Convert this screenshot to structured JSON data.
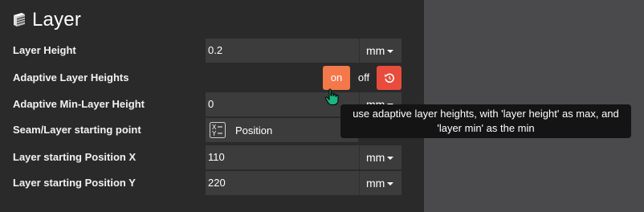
{
  "section": {
    "title": "Layer",
    "icon": "layers-stack-icon"
  },
  "rows": [
    {
      "label": "Layer Height",
      "value": "0.2",
      "unit": "mm"
    },
    {
      "label": "Adaptive Layer Heights",
      "toggle_on": "on",
      "toggle_off": "off",
      "state": "on"
    },
    {
      "label": "Adaptive Min-Layer Height",
      "value": "0",
      "unit": "mm"
    },
    {
      "label": "Seam/Layer starting point",
      "selected": "Position",
      "icon": "xy-coordinates-icon"
    },
    {
      "label": "Layer starting Position X",
      "value": "110",
      "unit": "mm"
    },
    {
      "label": "Layer starting Position Y",
      "value": "220",
      "unit": "mm"
    }
  ],
  "tooltip": {
    "line1": "use adaptive layer heights, with 'layer height' as max, and",
    "line2": "'layer min' as the min"
  },
  "colors": {
    "panel_bg": "#2a2a2a",
    "field_bg": "#3c3c3c",
    "toggle_on": "#f4784a",
    "reset_button": "#e84c3d",
    "tooltip_bg": "#141414",
    "right_bg": "#4a4a4d"
  }
}
